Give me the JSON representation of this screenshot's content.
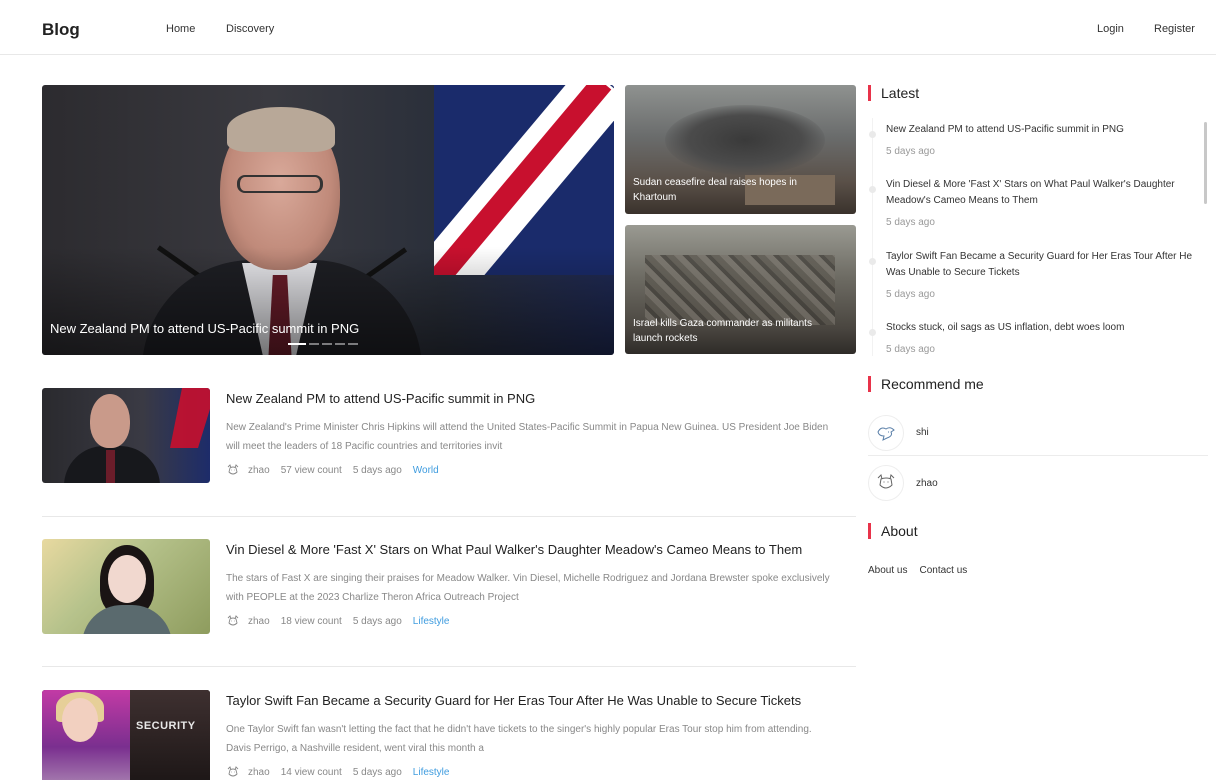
{
  "header": {
    "logo": "Blog",
    "nav": {
      "home": "Home",
      "discovery": "Discovery"
    },
    "auth": {
      "login": "Login",
      "register": "Register"
    }
  },
  "carousel": {
    "main": {
      "caption": "New Zealand PM to attend US-Pacific summit in PNG"
    },
    "slides_count": 5,
    "active_slide": 1,
    "side": [
      {
        "caption": "Sudan ceasefire deal raises hopes in Khartoum"
      },
      {
        "caption": "Israel kills Gaza commander as militants launch rockets"
      }
    ]
  },
  "articles": [
    {
      "title": "New Zealand PM to attend US-Pacific summit in PNG",
      "desc": "New Zealand's Prime Minister Chris Hipkins will attend the United States-Pacific Summit in Papua New Guinea. US President Joe Biden will meet the leaders of 18 Pacific countries and territories invit",
      "author": "zhao",
      "views": "57 view count",
      "time": "5 days ago",
      "category": "World"
    },
    {
      "title": "Vin Diesel & More 'Fast X' Stars on What Paul Walker's Daughter Meadow's Cameo Means to Them",
      "desc": "The stars of Fast X are singing their praises for Meadow Walker. Vin Diesel, Michelle Rodriguez and Jordana Brewster spoke exclusively with PEOPLE at the 2023 Charlize Theron Africa Outreach Project",
      "author": "zhao",
      "views": "18 view count",
      "time": "5 days ago",
      "category": "Lifestyle"
    },
    {
      "title": "Taylor Swift Fan Became a Security Guard for Her Eras Tour After He Was Unable to Secure Tickets",
      "desc": "One Taylor Swift fan wasn't letting the fact that he didn't have tickets to the singer's highly popular Eras Tour stop him from attending. Davis Perrigo, a Nashville resident, went viral this month a",
      "author": "zhao",
      "views": "14 view count",
      "time": "5 days ago",
      "category": "Lifestyle",
      "thumb_text": "SECURITY"
    }
  ],
  "sidebar": {
    "latest": {
      "title": "Latest",
      "items": [
        {
          "title": "New Zealand PM to attend US-Pacific summit in PNG",
          "time": "5 days ago"
        },
        {
          "title": "Vin Diesel & More 'Fast X' Stars on What Paul Walker's Daughter Meadow's Cameo Means to Them",
          "time": "5 days ago"
        },
        {
          "title": "Taylor Swift Fan Became a Security Guard for Her Eras Tour After He Was Unable to Secure Tickets",
          "time": "5 days ago"
        },
        {
          "title": "Stocks stuck, oil sags as US inflation, debt woes loom",
          "time": "5 days ago"
        }
      ]
    },
    "recommend": {
      "title": "Recommend me",
      "users": [
        {
          "name": "shi"
        },
        {
          "name": "zhao"
        }
      ]
    },
    "about": {
      "title": "About",
      "links": {
        "about_us": "About us",
        "contact_us": "Contact us"
      }
    }
  },
  "colors": {
    "accent": "#e8334a",
    "category_link": "#3f9cdf"
  }
}
